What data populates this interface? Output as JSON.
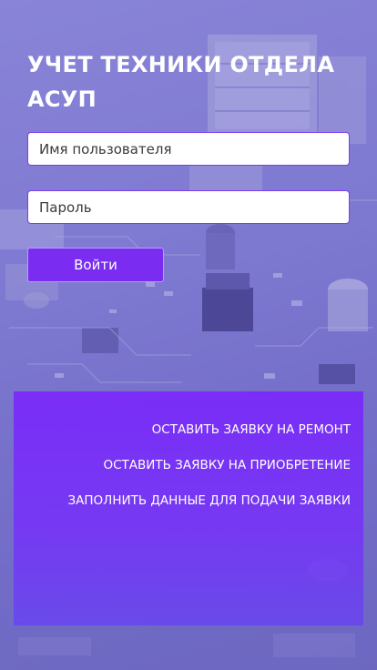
{
  "header": {
    "title": "УЧЕТ ТЕХНИКИ ОТДЕЛА АСУП"
  },
  "login_form": {
    "username_placeholder": "Имя пользователя",
    "password_placeholder": "Пароль",
    "submit_label": "Войти"
  },
  "actions_panel": {
    "links": [
      {
        "label": "ОСТАВИТЬ ЗАЯВКУ НА РЕМОНТ"
      },
      {
        "label": "ОСТАВИТЬ ЗАЯВКУ НА ПРИОБРЕТЕНИЕ"
      },
      {
        "label": "ЗАПОЛНИТЬ ДАННЫЕ ДЛЯ ПОДАЧИ ЗАЯВКИ"
      }
    ]
  },
  "colors": {
    "background_tint": "#7c78cf",
    "accent_purple": "#7a2df0",
    "field_border": "#7b3df0",
    "panel": "#7a28fa",
    "text_light": "#ffffff"
  }
}
